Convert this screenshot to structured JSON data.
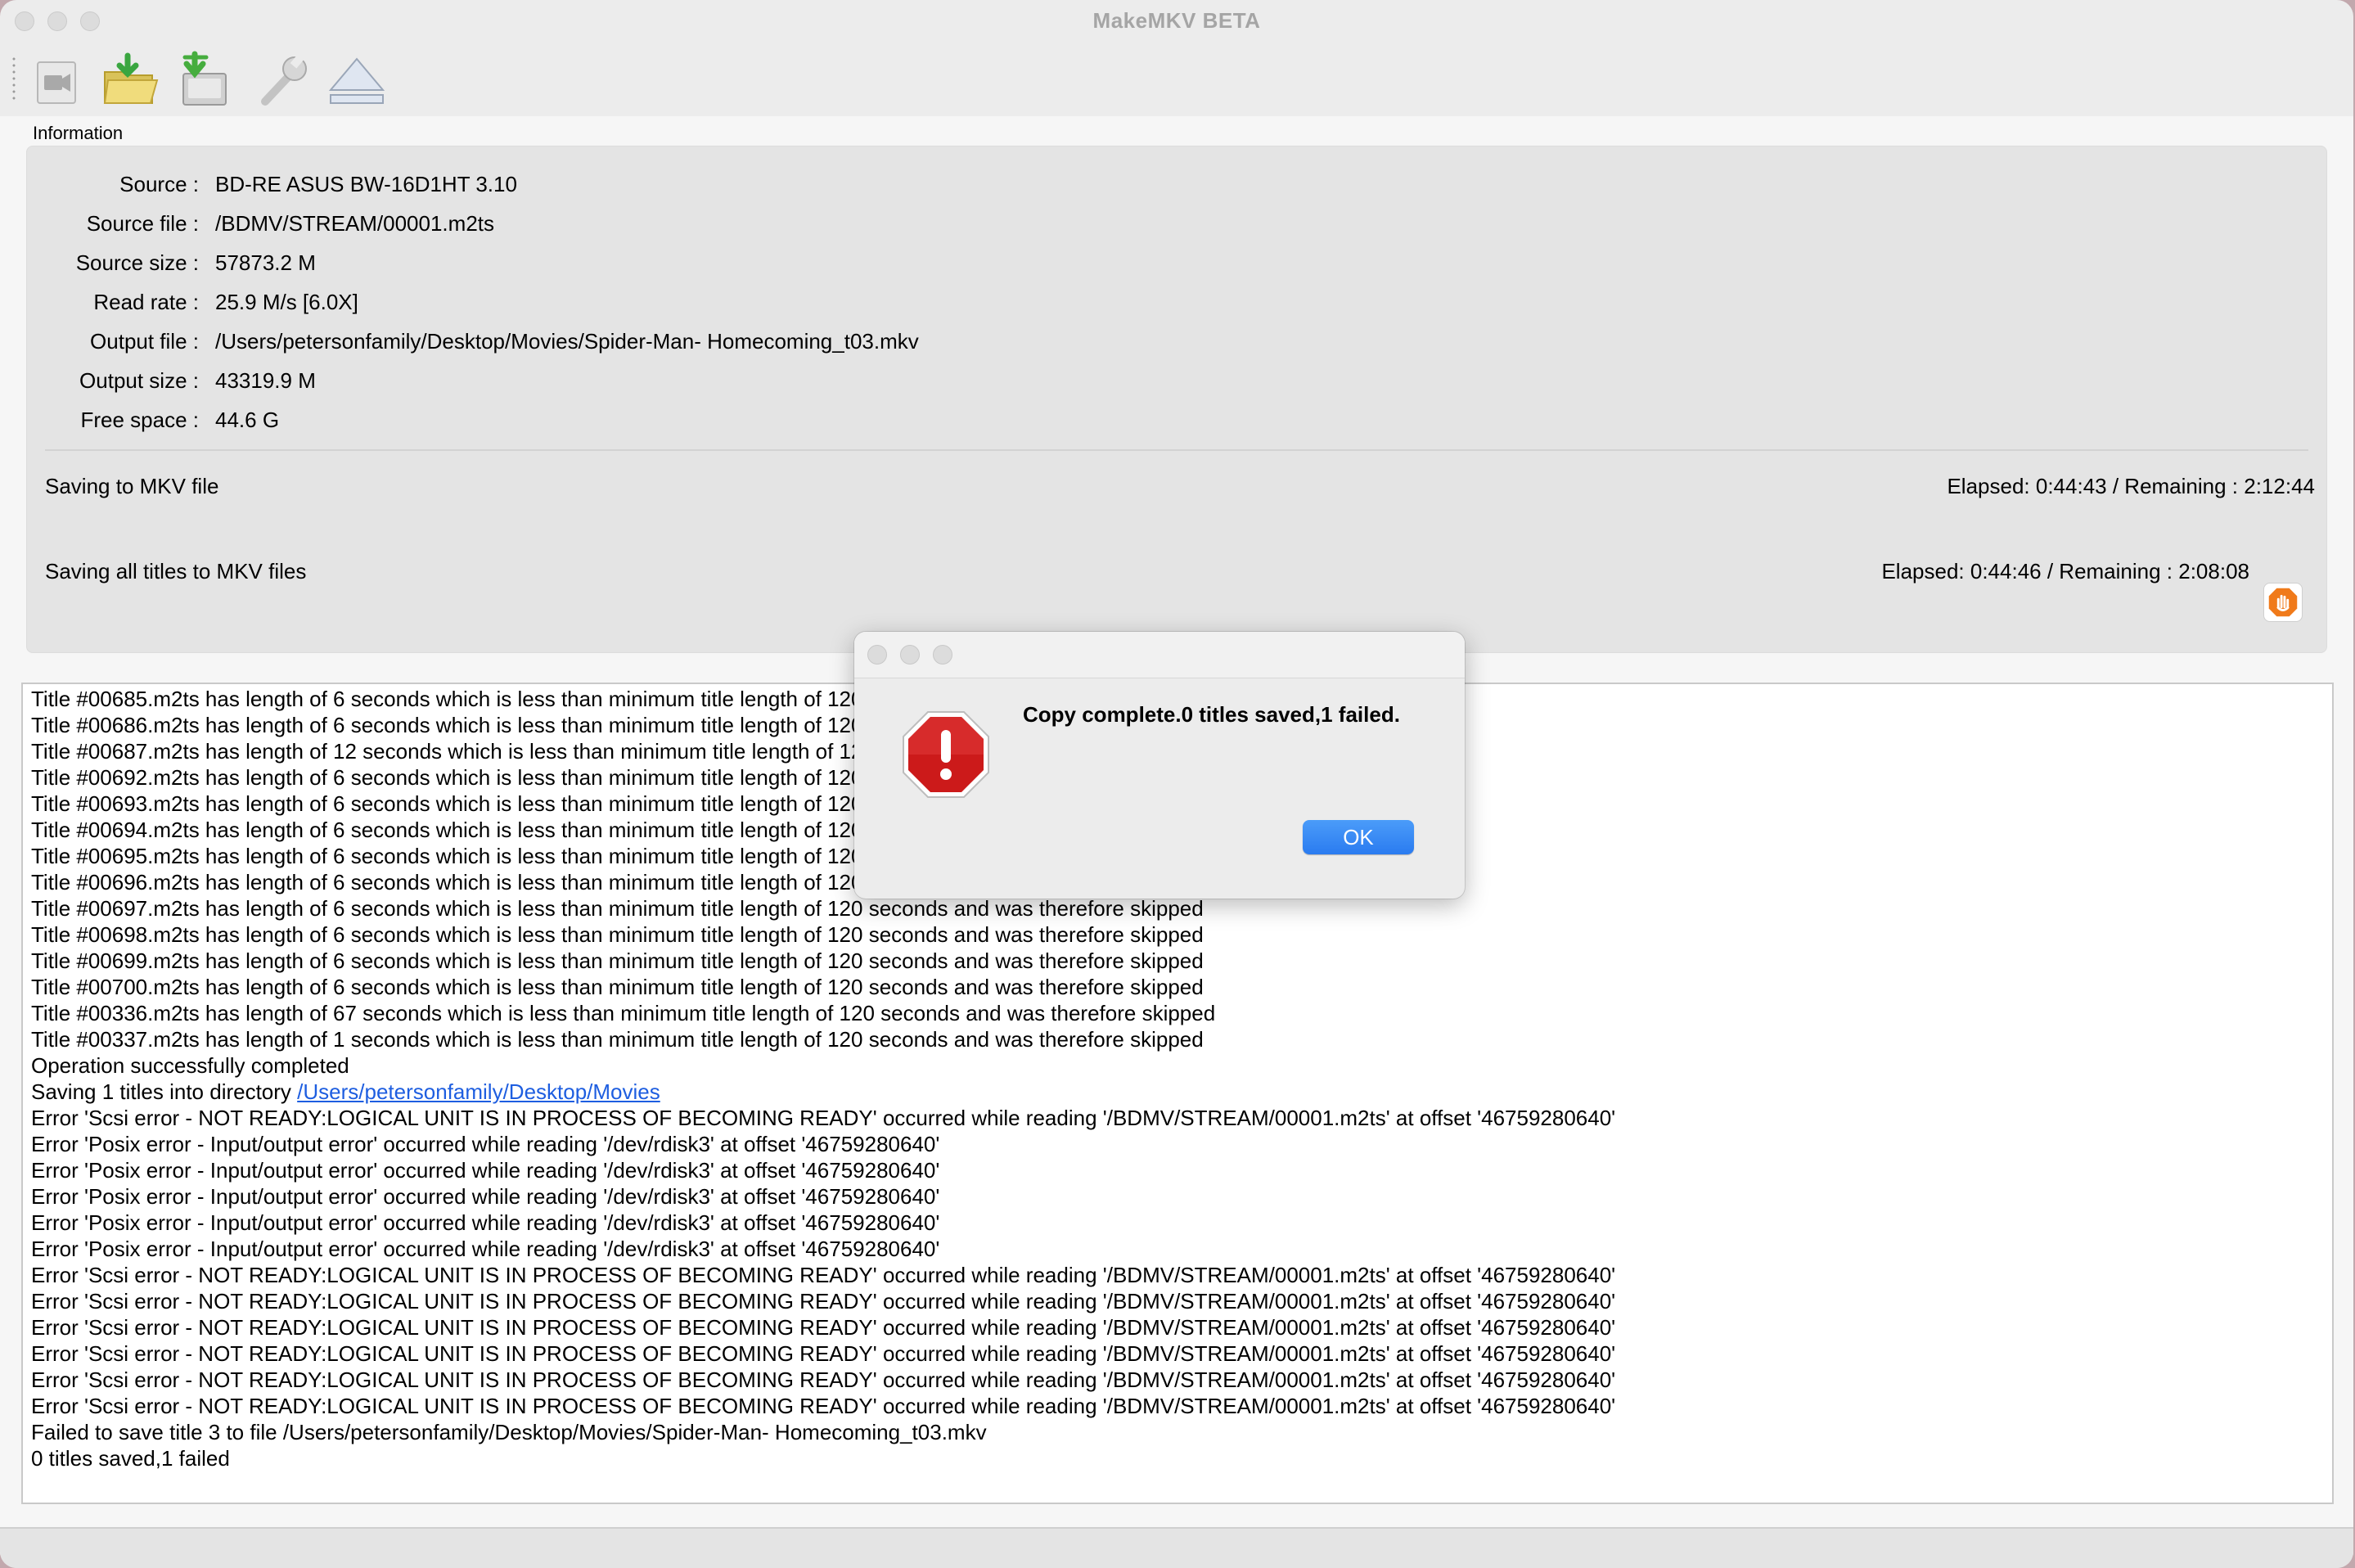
{
  "window": {
    "title": "MakeMKV BETA"
  },
  "toolbar": {
    "buttons": [
      {
        "name": "open-disc-icon"
      },
      {
        "name": "open-files-icon"
      },
      {
        "name": "backup-icon"
      },
      {
        "name": "preferences-wrench-icon"
      },
      {
        "name": "eject-icon"
      }
    ]
  },
  "information": {
    "section_label": "Information",
    "rows": [
      {
        "label": "Source :",
        "value": "BD-RE ASUS BW-16D1HT 3.10"
      },
      {
        "label": "Source file :",
        "value": "/BDMV/STREAM/00001.m2ts"
      },
      {
        "label": "Source size :",
        "value": "57873.2 M"
      },
      {
        "label": "Read rate :",
        "value": "25.9 M/s [6.0X]"
      },
      {
        "label": "Output file :",
        "value": "/Users/petersonfamily/Desktop/Movies/Spider-Man- Homecoming_t03.mkv"
      },
      {
        "label": "Output size :",
        "value": "43319.9 M"
      },
      {
        "label": "Free space :",
        "value": "44.6 G"
      }
    ],
    "status1": {
      "label": "Saving to MKV file",
      "time": "Elapsed: 0:44:43 / Remaining : 2:12:44"
    },
    "status2": {
      "label": "Saving all titles to MKV files",
      "time": "Elapsed: 0:44:46 / Remaining : 2:08:08"
    }
  },
  "log": {
    "lines": [
      "Title #00685.m2ts has length of 6 seconds which is less than minimum title length of 120 seconds and was therefore skipped",
      "Title #00686.m2ts has length of 6 seconds which is less than minimum title length of 120 seconds and was therefore skipped",
      "Title #00687.m2ts has length of 12 seconds which is less than minimum title length of 120 seconds and was therefore skipped",
      "Title #00692.m2ts has length of 6 seconds which is less than minimum title length of 120 seconds and was therefore skipped",
      "Title #00693.m2ts has length of 6 seconds which is less than minimum title length of 120 seconds and was therefore skipped",
      "Title #00694.m2ts has length of 6 seconds which is less than minimum title length of 120 seconds and was therefore skipped",
      "Title #00695.m2ts has length of 6 seconds which is less than minimum title length of 120 seconds and was therefore skipped",
      "Title #00696.m2ts has length of 6 seconds which is less than minimum title length of 120 seconds and was therefore skipped",
      "Title #00697.m2ts has length of 6 seconds which is less than minimum title length of 120 seconds and was therefore skipped",
      "Title #00698.m2ts has length of 6 seconds which is less than minimum title length of 120 seconds and was therefore skipped",
      "Title #00699.m2ts has length of 6 seconds which is less than minimum title length of 120 seconds and was therefore skipped",
      "Title #00700.m2ts has length of 6 seconds which is less than minimum title length of 120 seconds and was therefore skipped",
      "Title #00336.m2ts has length of 67 seconds which is less than minimum title length of 120 seconds and was therefore skipped",
      "Title #00337.m2ts has length of 1 seconds which is less than minimum title length of 120 seconds and was therefore skipped",
      "Operation successfully completed",
      "Saving 1 titles into directory ",
      "Error 'Scsi error - NOT READY:LOGICAL UNIT IS IN PROCESS OF BECOMING READY' occurred while reading '/BDMV/STREAM/00001.m2ts' at offset '46759280640'",
      "Error 'Posix error - Input/output error' occurred while reading '/dev/rdisk3' at offset '46759280640'",
      "Error 'Posix error - Input/output error' occurred while reading '/dev/rdisk3' at offset '46759280640'",
      "Error 'Posix error - Input/output error' occurred while reading '/dev/rdisk3' at offset '46759280640'",
      "Error 'Posix error - Input/output error' occurred while reading '/dev/rdisk3' at offset '46759280640'",
      "Error 'Posix error - Input/output error' occurred while reading '/dev/rdisk3' at offset '46759280640'",
      "Error 'Scsi error - NOT READY:LOGICAL UNIT IS IN PROCESS OF BECOMING READY' occurred while reading '/BDMV/STREAM/00001.m2ts' at offset '46759280640'",
      "Error 'Scsi error - NOT READY:LOGICAL UNIT IS IN PROCESS OF BECOMING READY' occurred while reading '/BDMV/STREAM/00001.m2ts' at offset '46759280640'",
      "Error 'Scsi error - NOT READY:LOGICAL UNIT IS IN PROCESS OF BECOMING READY' occurred while reading '/BDMV/STREAM/00001.m2ts' at offset '46759280640'",
      "Error 'Scsi error - NOT READY:LOGICAL UNIT IS IN PROCESS OF BECOMING READY' occurred while reading '/BDMV/STREAM/00001.m2ts' at offset '46759280640'",
      "Error 'Scsi error - NOT READY:LOGICAL UNIT IS IN PROCESS OF BECOMING READY' occurred while reading '/BDMV/STREAM/00001.m2ts' at offset '46759280640'",
      "Error 'Scsi error - NOT READY:LOGICAL UNIT IS IN PROCESS OF BECOMING READY' occurred while reading '/BDMV/STREAM/00001.m2ts' at offset '46759280640'",
      "Failed to save title 3 to file /Users/petersonfamily/Desktop/Movies/Spider-Man- Homecoming_t03.mkv",
      "0 titles saved,1 failed"
    ],
    "directory_link": "/Users/petersonfamily/Desktop/Movies"
  },
  "dialog": {
    "icon": "error-stop-icon",
    "message": "Copy complete.0 titles saved,1 failed.",
    "ok_label": "OK"
  },
  "colors": {
    "accent": "#2a7bf0",
    "error_red": "#cc1a1a",
    "link": "#1e5ee0"
  }
}
